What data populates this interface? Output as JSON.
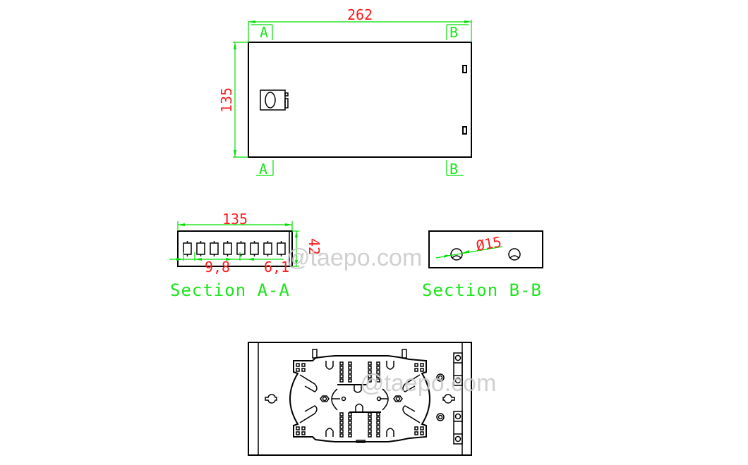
{
  "drawing": {
    "colors": {
      "outline": "#000000",
      "dimension_line": "#00e000",
      "dimension_text": "#ff1a1a",
      "section_label": "#19e619",
      "watermark": "#c8c8c8"
    },
    "top_view": {
      "width_dim": "262",
      "height_dim": "135",
      "section_marks": {
        "top_left": "A",
        "top_right": "B",
        "bottom_left": "A",
        "bottom_right": "B"
      }
    },
    "section_aa": {
      "title": "Section A-A",
      "width_dim": "135",
      "height_dim": "42",
      "pitch_dim": "9,8",
      "gap_dim": "6,1",
      "port_count": 8
    },
    "section_bb": {
      "title": "Section B-B",
      "hole_dim": "Ø15",
      "hole_count": 2
    },
    "watermarks": [
      "@taepo.com",
      "@taepo.com"
    ]
  }
}
